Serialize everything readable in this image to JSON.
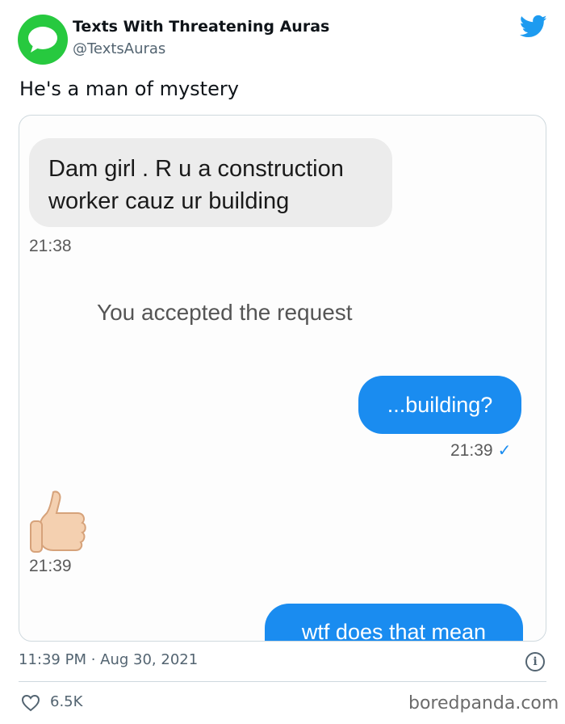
{
  "tweet": {
    "display_name": "Texts With Threatening Auras",
    "handle": "@TextsAuras",
    "text": "He's a man of mystery",
    "timestamp": "11:39 PM · Aug 30, 2021",
    "likes": "6.5K",
    "icons": {
      "avatar": "messages-app-bubble-icon",
      "logo": "twitter-bird-icon",
      "info": "info-icon",
      "like": "heart-icon"
    },
    "colors": {
      "avatar_bg": "#27c93f",
      "twitter_blue": "#1d9bf0"
    }
  },
  "conversation": {
    "incoming_1": {
      "text_line1": "Dam girl . R u a construction",
      "text_line2": "worker cauz ur building",
      "time": "21:38"
    },
    "system_message": "You accepted the request",
    "outgoing_1": {
      "text": "...building?",
      "time": "21:39",
      "status_icon": "✓"
    },
    "incoming_2": {
      "emoji": "thumbs-up-icon",
      "time": "21:39"
    },
    "outgoing_2": {
      "text": "wtf does that mean"
    },
    "colors": {
      "incoming_bg": "#ececec",
      "outgoing_bg": "#1a8cf0"
    }
  },
  "watermark": "boredpanda.com"
}
